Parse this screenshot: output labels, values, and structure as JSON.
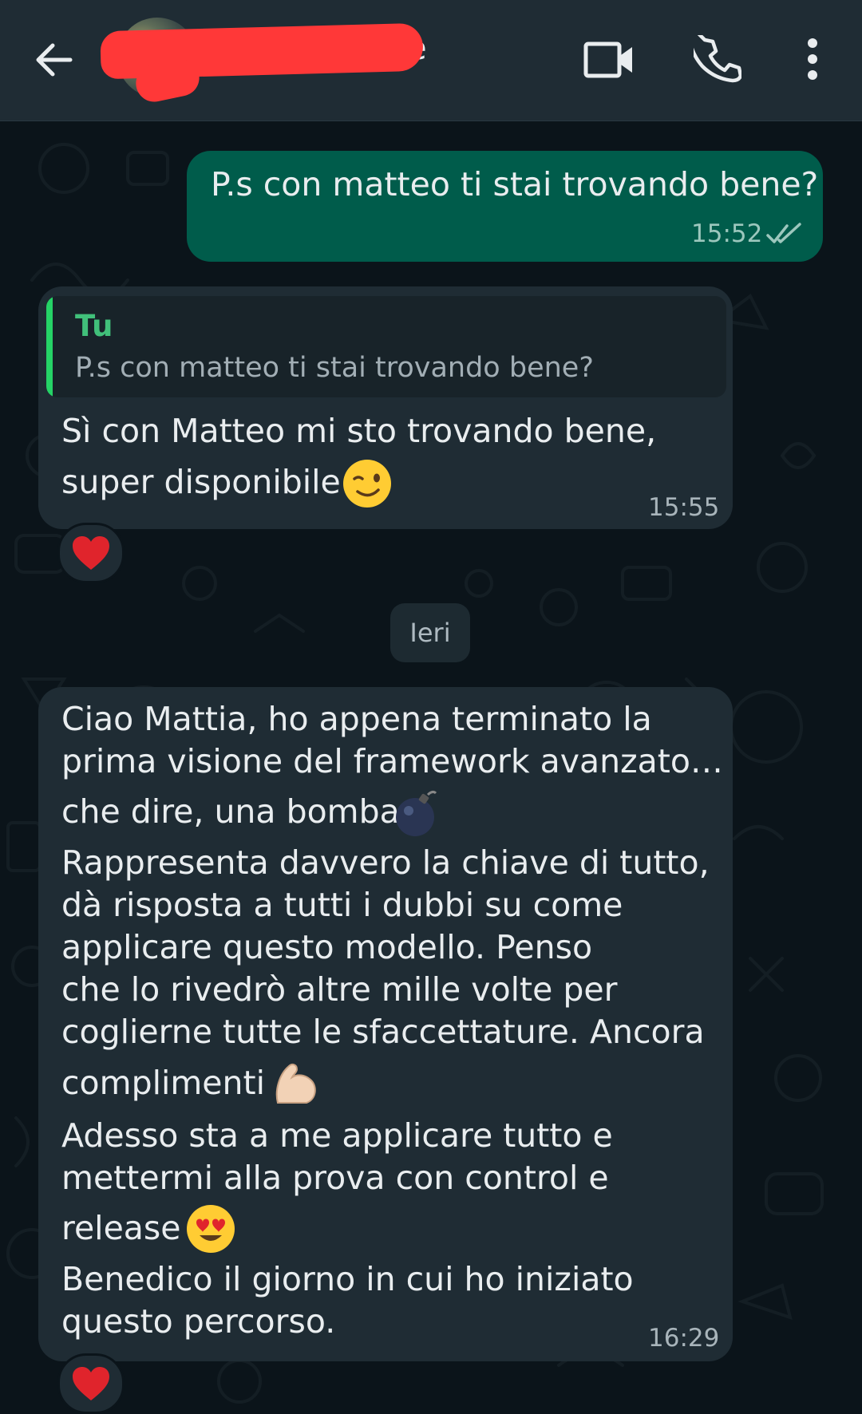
{
  "header": {
    "contact_name_visible": "e",
    "back_icon": "back-arrow-icon",
    "video_icon": "video-camera-icon",
    "call_icon": "phone-icon",
    "menu_icon": "more-vertical-icon"
  },
  "colors": {
    "outgoing_bubble": "#005c4b",
    "incoming_bubble": "#1f2c34",
    "background": "#0b141a",
    "quote_accent": "#25d366"
  },
  "messages": {
    "m1": {
      "direction": "outgoing",
      "text": "P.s con matteo ti stai trovando bene?",
      "time": "15:52",
      "status": "read"
    },
    "m2": {
      "direction": "incoming",
      "quote_author": "Tu",
      "quote_text": "P.s con matteo ti stai trovando bene?",
      "line1": "Sì con Matteo mi sto trovando bene,",
      "line2": "super disponibile",
      "emoji": "winking-face",
      "time": "15:55",
      "reaction": "red-heart"
    },
    "date_divider": "Ieri",
    "m3": {
      "direction": "incoming",
      "line1": "Ciao Mattia, ho appena terminato la",
      "line2": "prima visione del framework avanzato…",
      "line3": "che dire, una bomba",
      "line4": "Rappresenta davvero la chiave di tutto,",
      "line5": "dà risposta a tutti i dubbi su come",
      "line6": "applicare questo modello. Penso",
      "line7": "che lo rivedrò altre mille volte per",
      "line8": "coglierne tutte le sfaccettature. Ancora",
      "line9": "complimenti",
      "line10": "Adesso sta a me applicare tutto e",
      "line11": "mettermi alla prova con control e",
      "line12": "release",
      "line13": "Benedico il giorno in cui ho iniziato",
      "line14": "questo percorso.",
      "emojis": [
        "bomb",
        "flexed-biceps",
        "smiling-face-with-heart-eyes"
      ],
      "time": "16:29",
      "reaction": "red-heart"
    }
  }
}
